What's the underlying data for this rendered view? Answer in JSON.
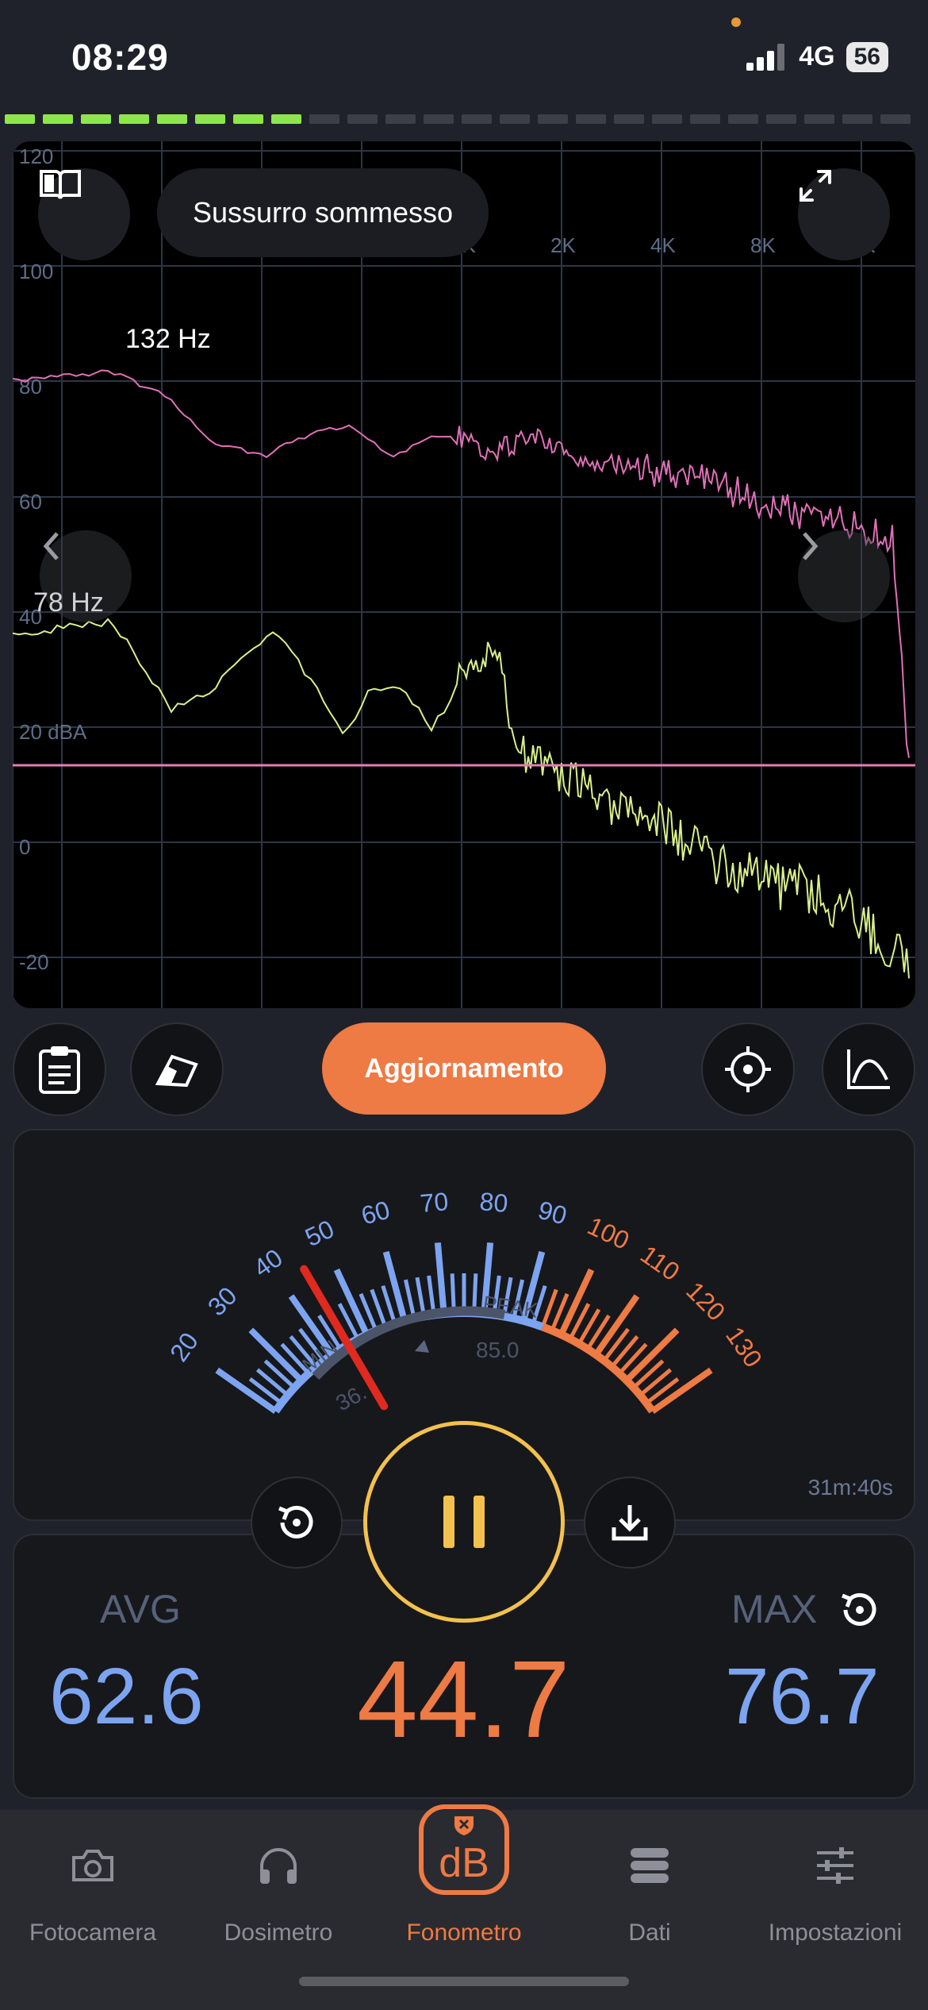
{
  "status": {
    "time": "08:29",
    "network": "4G",
    "battery": "56"
  },
  "level_meter": {
    "active_segments": 8,
    "total_segments": 24
  },
  "spectrum": {
    "description_label": "Sussurro sommesso",
    "freq_labels": [
      "2",
      "1K",
      "2K",
      "4K",
      "8K",
      "6K"
    ],
    "db_labels": [
      "120",
      "100",
      "80",
      "60",
      "40",
      "20 dBA",
      "0",
      "-20"
    ],
    "peak_pink_label": "132 Hz",
    "peak_yellow_label": "78 Hz",
    "colors": {
      "pink": "#e070b8",
      "yellow": "#d9f08a",
      "grid": "#2c3645",
      "threshold": "#e27fb4"
    }
  },
  "toolbar": {
    "update_label": "Aggiornamento"
  },
  "gauge": {
    "scale_blue": [
      "20",
      "30",
      "40",
      "50",
      "60",
      "70",
      "80",
      "90"
    ],
    "scale_orange": [
      "100",
      "110",
      "120",
      "130"
    ],
    "min_label": "MIN",
    "min_value": "36.",
    "peak_label": "PEAK",
    "peak_value": "85.0",
    "elapsed": "31m:40s",
    "needle_db": 44.7,
    "colors": {
      "blue": "#7da4f0",
      "orange": "#ee7a44",
      "needle": "#e02a1f",
      "pause": "#f2c14e"
    }
  },
  "stats": {
    "avg_label": "AVG",
    "avg_value": "62.6",
    "current_value": "44.7",
    "max_label": "MAX",
    "max_value": "76.7"
  },
  "tabs": [
    {
      "label": "Fotocamera",
      "icon": "camera-icon"
    },
    {
      "label": "Dosimetro",
      "icon": "headphones-icon"
    },
    {
      "label": "Fonometro",
      "icon": "db-meter-icon",
      "active": true
    },
    {
      "label": "Dati",
      "icon": "database-icon"
    },
    {
      "label": "Impostazioni",
      "icon": "sliders-icon"
    }
  ]
}
